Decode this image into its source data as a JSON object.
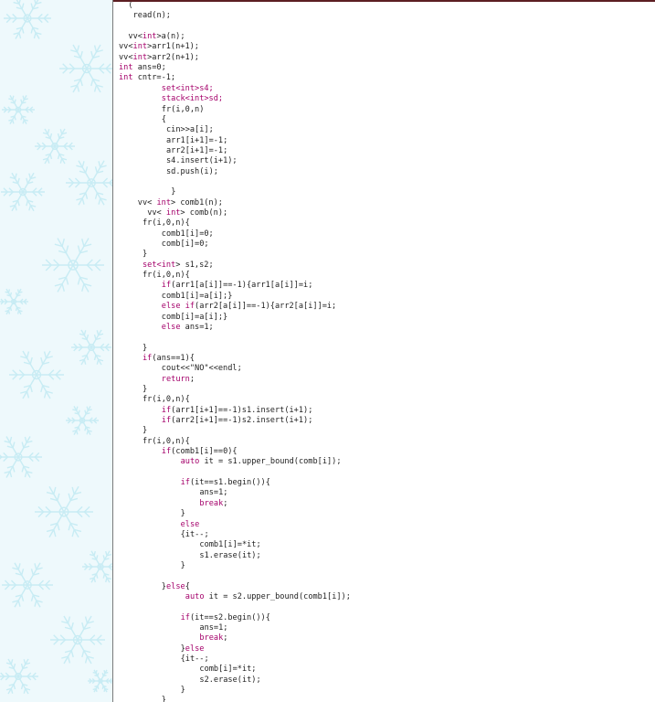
{
  "colors": {
    "code_text": "#1e1e1e",
    "keyword": "#a4006a",
    "background": "#ffffff",
    "sidebar_background": "#eef9fc",
    "snowflake": "#c8ecf4"
  },
  "sidebar": {
    "pattern_icon": "snowflake-icon"
  },
  "code": {
    "lines": [
      {
        "indent": 0,
        "parts": [
          {
            "t": "  ("
          }
        ]
      },
      {
        "indent": 3,
        "parts": [
          {
            "t": "read(n);"
          }
        ]
      },
      {
        "indent": 0,
        "parts": [
          {
            "t": ""
          }
        ]
      },
      {
        "indent": 2,
        "parts": [
          {
            "t": "vv<"
          },
          {
            "t": "int",
            "k": 1
          },
          {
            "t": ">a(n);"
          }
        ]
      },
      {
        "indent": 0,
        "parts": [
          {
            "t": "vv<"
          },
          {
            "t": "int",
            "k": 1
          },
          {
            "t": ">arr1(n+1);"
          }
        ]
      },
      {
        "indent": 0,
        "parts": [
          {
            "t": "vv<"
          },
          {
            "t": "int",
            "k": 1
          },
          {
            "t": ">arr2(n+1);"
          }
        ]
      },
      {
        "indent": 0,
        "parts": [
          {
            "t": "int",
            "k": 1
          },
          {
            "t": " ans=0;"
          }
        ]
      },
      {
        "indent": 0,
        "parts": [
          {
            "t": "int",
            "k": 1
          },
          {
            "t": " cntr=-1;"
          }
        ]
      },
      {
        "indent": 9,
        "parts": [
          {
            "t": "set<",
            "k": 1
          },
          {
            "t": "int",
            "k": 1
          },
          {
            "t": ">s4;",
            "k": 1
          }
        ]
      },
      {
        "indent": 9,
        "parts": [
          {
            "t": "stack<",
            "k": 1
          },
          {
            "t": "int",
            "k": 1
          },
          {
            "t": ">sd;",
            "k": 1
          }
        ]
      },
      {
        "indent": 9,
        "parts": [
          {
            "t": "fr(i,0,n)"
          }
        ]
      },
      {
        "indent": 9,
        "parts": [
          {
            "t": "{"
          }
        ]
      },
      {
        "indent": 10,
        "parts": [
          {
            "t": "cin>>a[i];"
          }
        ]
      },
      {
        "indent": 10,
        "parts": [
          {
            "t": "arr1[i+1]=-1;"
          }
        ]
      },
      {
        "indent": 10,
        "parts": [
          {
            "t": "arr2[i+1]=-1;"
          }
        ]
      },
      {
        "indent": 10,
        "parts": [
          {
            "t": "s4.insert(i+1);"
          }
        ]
      },
      {
        "indent": 10,
        "parts": [
          {
            "t": "sd.push(i);"
          }
        ]
      },
      {
        "indent": 0,
        "parts": [
          {
            "t": ""
          }
        ]
      },
      {
        "indent": 11,
        "parts": [
          {
            "t": "}"
          }
        ]
      },
      {
        "indent": 4,
        "parts": [
          {
            "t": "vv< "
          },
          {
            "t": "int",
            "k": 1
          },
          {
            "t": "> comb1(n);"
          }
        ]
      },
      {
        "indent": 6,
        "parts": [
          {
            "t": "vv< "
          },
          {
            "t": "int",
            "k": 1
          },
          {
            "t": "> comb(n);"
          }
        ]
      },
      {
        "indent": 5,
        "parts": [
          {
            "t": "fr(i,0,n){"
          }
        ]
      },
      {
        "indent": 9,
        "parts": [
          {
            "t": "comb1[i]=0;"
          }
        ]
      },
      {
        "indent": 9,
        "parts": [
          {
            "t": "comb[i]=0;"
          }
        ]
      },
      {
        "indent": 5,
        "parts": [
          {
            "t": "}"
          }
        ]
      },
      {
        "indent": 5,
        "parts": [
          {
            "t": "set<",
            "k": 1
          },
          {
            "t": "int",
            "k": 1
          },
          {
            "t": "> s1,s2;"
          }
        ]
      },
      {
        "indent": 5,
        "parts": [
          {
            "t": "fr(i,0,n){"
          }
        ]
      },
      {
        "indent": 9,
        "parts": [
          {
            "t": "if",
            "k": 1
          },
          {
            "t": "(arr1[a[i]]==-1){arr1[a[i]]=i;"
          }
        ]
      },
      {
        "indent": 9,
        "parts": [
          {
            "t": "comb1[i]=a[i];}"
          }
        ]
      },
      {
        "indent": 9,
        "parts": [
          {
            "t": "else if",
            "k": 1
          },
          {
            "t": "(arr2[a[i]]==-1){arr2[a[i]]=i;"
          }
        ]
      },
      {
        "indent": 9,
        "parts": [
          {
            "t": "comb[i]=a[i];}"
          }
        ]
      },
      {
        "indent": 9,
        "parts": [
          {
            "t": "else",
            "k": 1
          },
          {
            "t": " ans=1;"
          }
        ]
      },
      {
        "indent": 0,
        "parts": [
          {
            "t": ""
          }
        ]
      },
      {
        "indent": 5,
        "parts": [
          {
            "t": "}"
          }
        ]
      },
      {
        "indent": 5,
        "parts": [
          {
            "t": "if",
            "k": 1
          },
          {
            "t": "(ans==1){"
          }
        ]
      },
      {
        "indent": 9,
        "parts": [
          {
            "t": "cout<<\"NO\"<<endl;"
          }
        ]
      },
      {
        "indent": 9,
        "parts": [
          {
            "t": "return",
            "k": 1
          },
          {
            "t": ";"
          }
        ]
      },
      {
        "indent": 5,
        "parts": [
          {
            "t": "}"
          }
        ]
      },
      {
        "indent": 5,
        "parts": [
          {
            "t": "fr(i,0,n){"
          }
        ]
      },
      {
        "indent": 9,
        "parts": [
          {
            "t": "if",
            "k": 1
          },
          {
            "t": "(arr1[i+1]==-1)s1.insert(i+1);"
          }
        ]
      },
      {
        "indent": 9,
        "parts": [
          {
            "t": "if",
            "k": 1
          },
          {
            "t": "(arr2[i+1]==-1)s2.insert(i+1);"
          }
        ]
      },
      {
        "indent": 5,
        "parts": [
          {
            "t": "}"
          }
        ]
      },
      {
        "indent": 5,
        "parts": [
          {
            "t": "fr(i,0,n){"
          }
        ]
      },
      {
        "indent": 9,
        "parts": [
          {
            "t": "if",
            "k": 1
          },
          {
            "t": "(comb1[i]==0){"
          }
        ]
      },
      {
        "indent": 13,
        "parts": [
          {
            "t": "auto",
            "k": 1
          },
          {
            "t": " it = s1.upper_bound(comb[i]);"
          }
        ]
      },
      {
        "indent": 0,
        "parts": [
          {
            "t": ""
          }
        ]
      },
      {
        "indent": 13,
        "parts": [
          {
            "t": "if",
            "k": 1
          },
          {
            "t": "(it==s1.begin()){"
          }
        ]
      },
      {
        "indent": 17,
        "parts": [
          {
            "t": "ans=1;"
          }
        ]
      },
      {
        "indent": 17,
        "parts": [
          {
            "t": "break",
            "k": 1
          },
          {
            "t": ";"
          }
        ]
      },
      {
        "indent": 13,
        "parts": [
          {
            "t": "}"
          }
        ]
      },
      {
        "indent": 13,
        "parts": [
          {
            "t": "else",
            "k": 1
          }
        ]
      },
      {
        "indent": 13,
        "parts": [
          {
            "t": "{it--;"
          }
        ]
      },
      {
        "indent": 17,
        "parts": [
          {
            "t": "comb1[i]=*it;"
          }
        ]
      },
      {
        "indent": 17,
        "parts": [
          {
            "t": "s1.erase(it);"
          }
        ]
      },
      {
        "indent": 13,
        "parts": [
          {
            "t": "}"
          }
        ]
      },
      {
        "indent": 0,
        "parts": [
          {
            "t": ""
          }
        ]
      },
      {
        "indent": 9,
        "parts": [
          {
            "t": "}"
          },
          {
            "t": "else",
            "k": 1
          },
          {
            "t": "{"
          }
        ]
      },
      {
        "indent": 14,
        "parts": [
          {
            "t": "auto",
            "k": 1
          },
          {
            "t": " it = s2.upper_bound(comb1[i]);"
          }
        ]
      },
      {
        "indent": 0,
        "parts": [
          {
            "t": ""
          }
        ]
      },
      {
        "indent": 13,
        "parts": [
          {
            "t": "if",
            "k": 1
          },
          {
            "t": "(it==s2.begin()){"
          }
        ]
      },
      {
        "indent": 17,
        "parts": [
          {
            "t": "ans=1;"
          }
        ]
      },
      {
        "indent": 17,
        "parts": [
          {
            "t": "break",
            "k": 1
          },
          {
            "t": ";"
          }
        ]
      },
      {
        "indent": 13,
        "parts": [
          {
            "t": "}"
          },
          {
            "t": "else",
            "k": 1
          }
        ]
      },
      {
        "indent": 13,
        "parts": [
          {
            "t": "{it--;"
          }
        ]
      },
      {
        "indent": 17,
        "parts": [
          {
            "t": "comb[i]=*it;"
          }
        ]
      },
      {
        "indent": 17,
        "parts": [
          {
            "t": "s2.erase(it);"
          }
        ]
      },
      {
        "indent": 13,
        "parts": [
          {
            "t": "}"
          }
        ]
      },
      {
        "indent": 9,
        "parts": [
          {
            "t": "}"
          }
        ]
      },
      {
        "indent": 5,
        "parts": [
          {
            "t": "}"
          }
        ]
      }
    ]
  }
}
